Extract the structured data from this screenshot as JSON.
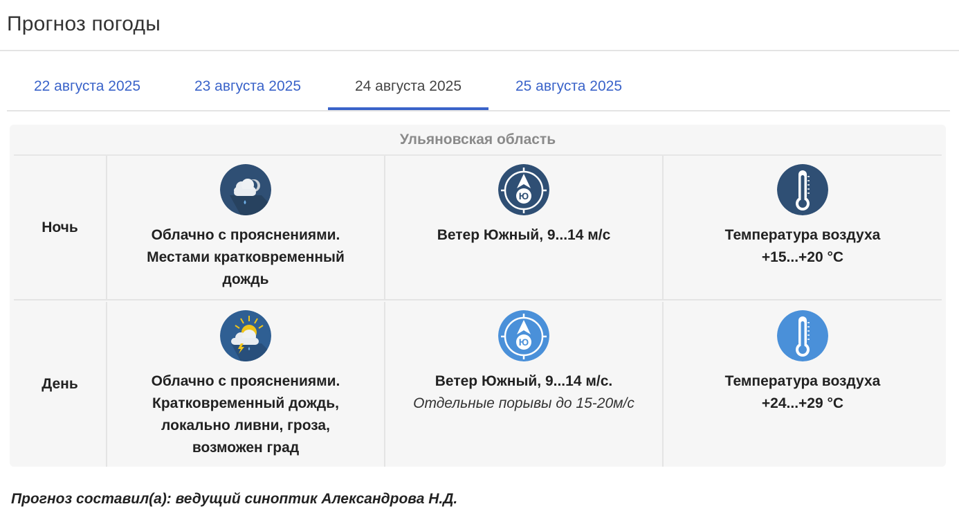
{
  "page": {
    "title": "Прогноз погоды"
  },
  "tabs": [
    {
      "label": "22 августа 2025",
      "active": false
    },
    {
      "label": "23 августа 2025",
      "active": false
    },
    {
      "label": "24 августа 2025",
      "active": true
    },
    {
      "label": "25 августа 2025",
      "active": false
    }
  ],
  "forecast": {
    "region": "Ульяновская область",
    "night": {
      "label": "Ночь",
      "weather_icon": "cloud-rain-night-icon",
      "weather": "Облачно с прояснениями. Местами кратковременный дождь",
      "wind_icon": "wind-south-icon",
      "wind_badge": "Ю",
      "wind": "Ветер Южный, 9...14 м/с",
      "temp_icon": "thermometer-icon",
      "temp_label": "Температура воздуха",
      "temp_value": "+15...+20 °С"
    },
    "day": {
      "label": "День",
      "weather_icon": "sun-cloud-thunder-icon",
      "weather": "Облачно с прояснениями. Кратковременный дождь, локально ливни, гроза, возможен град",
      "wind_icon": "wind-south-icon",
      "wind_badge": "Ю",
      "wind": "Ветер Южный, 9...14 м/с.",
      "wind_note": "Отдельные порывы до 15-20м/с",
      "temp_icon": "thermometer-icon",
      "temp_label": "Температура воздуха",
      "temp_value": "+24...+29 °С"
    }
  },
  "footer": {
    "text": "Прогноз составил(а): ведущий синоптик Александрова Н.Д."
  },
  "colors": {
    "accent": "#3a63c9",
    "night_icon": "#2f4f74",
    "day_icon": "#4a90d9"
  }
}
